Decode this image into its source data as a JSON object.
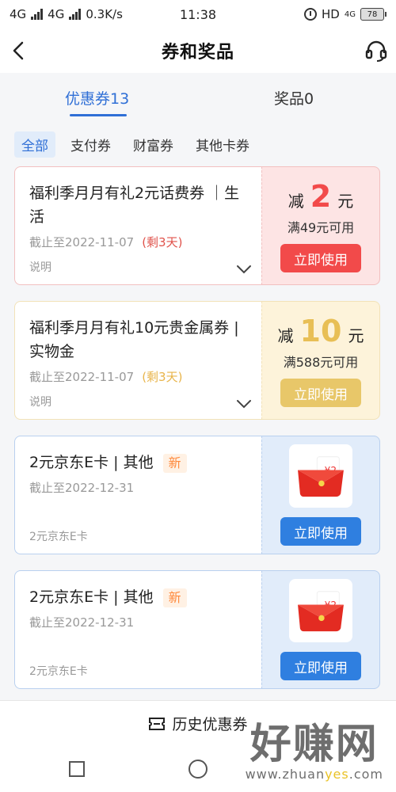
{
  "status_bar": {
    "net1": "4G",
    "net2": "4G",
    "speed": "0.3K/s",
    "time": "11:38",
    "hd": "HD",
    "net3": "4G",
    "battery": "78"
  },
  "nav": {
    "title": "券和奖品",
    "icons": {
      "back": "back-arrow-icon",
      "service": "headset-icon"
    }
  },
  "tabs": [
    {
      "label": "优惠券13"
    },
    {
      "label": "奖品0"
    }
  ],
  "filters": [
    {
      "label": "全部"
    },
    {
      "label": "支付券"
    },
    {
      "label": "财富券"
    },
    {
      "label": "其他卡券"
    }
  ],
  "cards": [
    {
      "title": "福利季月月有礼2元话费券 ｜生活",
      "date": "截止至2022-11-07",
      "remain": "(剩3天)",
      "note": "说明",
      "minus_label": "减",
      "amount": "2",
      "unit": "元",
      "min_spend": "满49元可用",
      "button": "立即使用",
      "color": "#f24a4a"
    },
    {
      "title": "福利季月月有礼10元贵金属券 |实物金",
      "date": "截止至2022-11-07",
      "remain": "(剩3天)",
      "note": "说明",
      "minus_label": "减",
      "amount": "10",
      "unit": "元",
      "min_spend": "满588元可用",
      "button": "立即使用",
      "color": "#e8c769"
    },
    {
      "title": "2元京东E卡 | 其他",
      "badge": "新",
      "date": "截止至2022-12-31",
      "note": "2元京东E卡",
      "button": "立即使用",
      "gift_icon": "red-envelope-icon",
      "gift_text": "¥2",
      "color": "#2f7fe0"
    },
    {
      "title": "2元京东E卡 | 其他",
      "badge": "新",
      "date": "截止至2022-12-31",
      "note": "2元京东E卡",
      "button": "立即使用",
      "gift_icon": "red-envelope-icon",
      "gift_text": "¥2",
      "color": "#2f7fe0"
    }
  ],
  "history": {
    "label": "历史优惠券",
    "icon": "ticket-icon"
  },
  "watermark": {
    "main": "好赚网",
    "sub_a": "www.zhuan",
    "sub_b": "yes",
    "sub_c": ".com"
  }
}
